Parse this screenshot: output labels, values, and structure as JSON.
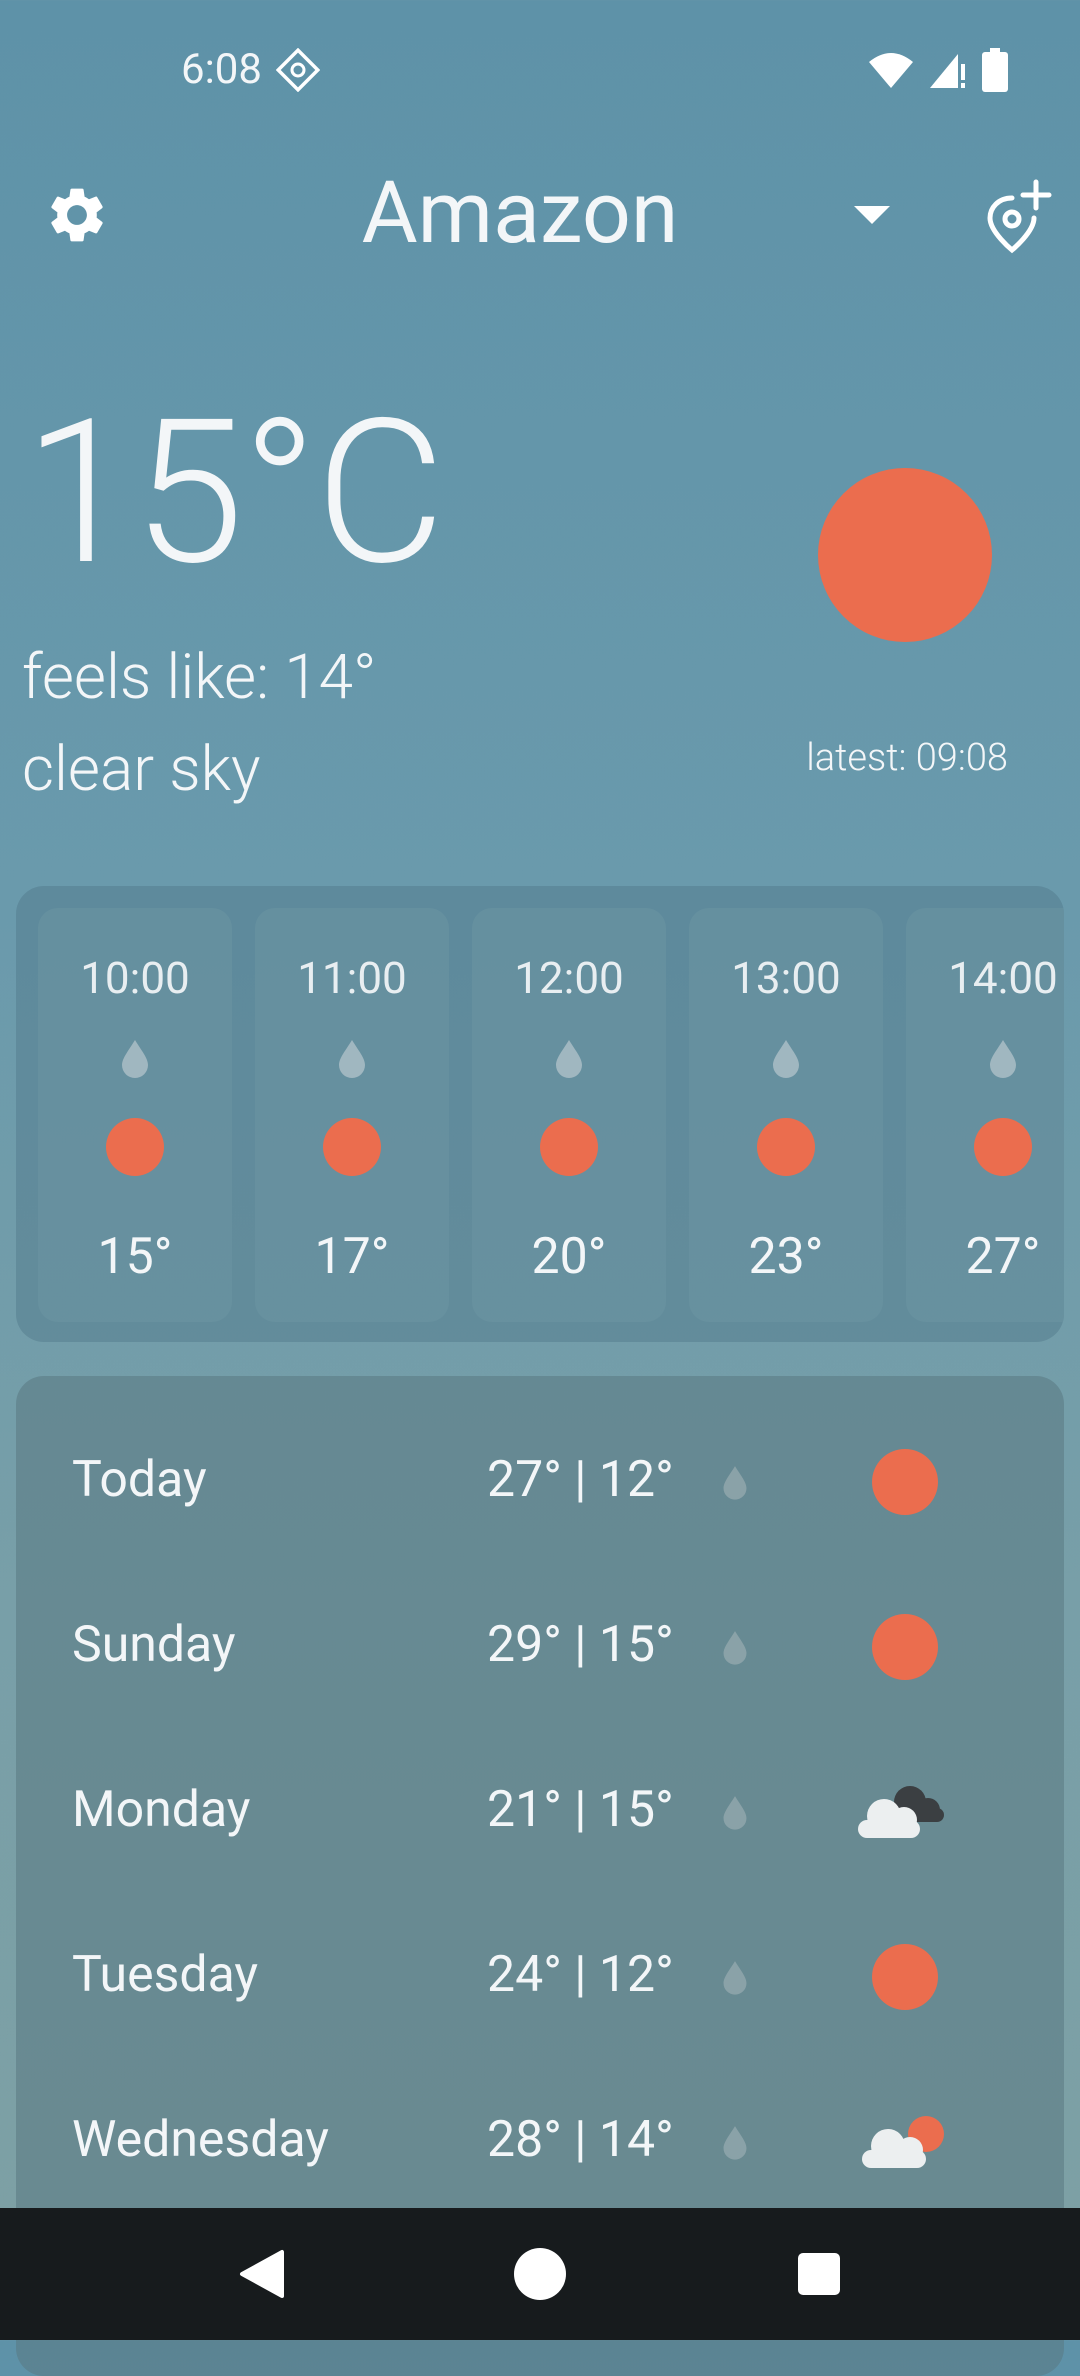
{
  "status_bar": {
    "time": "6:08",
    "icons": [
      "record-icon",
      "wifi-icon",
      "cellular-signal-icon",
      "battery-icon"
    ]
  },
  "header": {
    "location": "Amazon",
    "settings_icon": "gear-icon",
    "dropdown_icon": "caret-down-icon",
    "add_location_icon": "add-location-pin-icon"
  },
  "current": {
    "temperature": "15°C",
    "feels_like": "feels like: 14°",
    "condition": "clear sky",
    "latest": "latest: 09:08",
    "condition_icon": "sun-icon"
  },
  "hourly": [
    {
      "time": "10:00",
      "temp": "15°",
      "icon": "sun-icon"
    },
    {
      "time": "11:00",
      "temp": "17°",
      "icon": "sun-icon"
    },
    {
      "time": "12:00",
      "temp": "20°",
      "icon": "sun-icon"
    },
    {
      "time": "13:00",
      "temp": "23°",
      "icon": "sun-icon"
    },
    {
      "time": "14:00",
      "temp": "27°",
      "icon": "sun-icon"
    }
  ],
  "daily": [
    {
      "day": "Today",
      "range": "27° | 12°",
      "icon": "sun-icon"
    },
    {
      "day": "Sunday",
      "range": "29° | 15°",
      "icon": "sun-icon"
    },
    {
      "day": "Monday",
      "range": "21° | 15°",
      "icon": "dark-clouds-icon"
    },
    {
      "day": "Tuesday",
      "range": "24° | 12°",
      "icon": "sun-icon"
    },
    {
      "day": "Wednesday",
      "range": "28° | 14°",
      "icon": "partly-cloudy-icon"
    }
  ],
  "colors": {
    "sun": "#eb6d4e",
    "background_top": "#5e92a8",
    "nav_bar": "#171b1d"
  },
  "nav_bar": {
    "icons": [
      "back-icon",
      "home-icon",
      "recents-icon"
    ]
  }
}
